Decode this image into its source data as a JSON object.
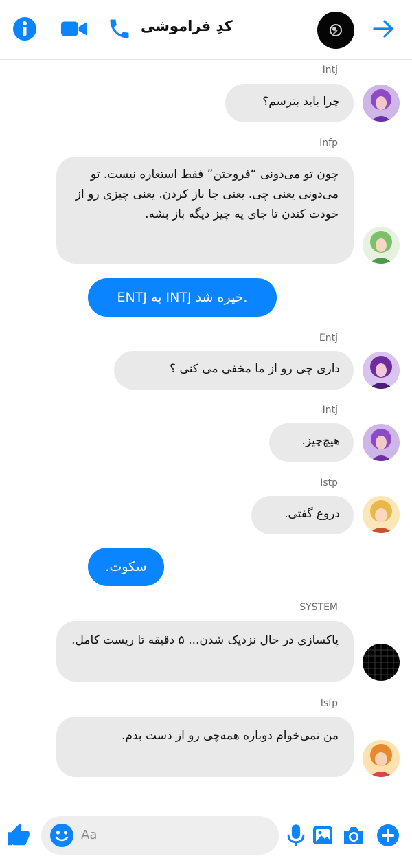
{
  "header": {
    "title": "کدِ فراموشی",
    "icons": [
      "info-icon",
      "video-call-icon",
      "phone-icon",
      "arrow-right-icon"
    ],
    "accent": "#0a84ff"
  },
  "messages": [
    {
      "sender": "Intj",
      "text": "چرا باید بترسم؟",
      "avatar": "purple-hair"
    },
    {
      "sender": "Infp",
      "text": "چون تو می‌دونی “فروختن” فقط استعاره نیست. تو می‌دونی یعنی چی. یعنی جا باز کردن. یعنی چیزی رو از خودت کندن تا جای یه چیز دیگه باز بشه.",
      "avatar": "green-hair"
    },
    {
      "outgoing": true,
      "text": ".خیره شد INTJ به ENTJ"
    },
    {
      "sender": "Entj",
      "text": "داری چی رو از ما مخفی می کنی ؟",
      "avatar": "purple-dark"
    },
    {
      "sender": "Intj",
      "text": "هیچ‌چیز.",
      "avatar": "purple-hair"
    },
    {
      "sender": "Istp",
      "text": "دروغ گفتی.",
      "avatar": "blonde"
    },
    {
      "outgoing": true,
      "text": "سکوت."
    },
    {
      "sender": "SYSTEM",
      "text": "پاکسازی در حال نزدیک شدن... ۵ دقیقه تا ریست کامل.",
      "avatar": "grid-black"
    },
    {
      "sender": "Isfp",
      "text": "من نمی‌خوام دوباره همه‌چی رو از دست بدم.",
      "avatar": "orange-hair"
    }
  ],
  "composer": {
    "placeholder": "Aa",
    "icons": [
      "like-icon",
      "emoji-icon",
      "mic-icon",
      "image-icon",
      "camera-icon",
      "plus-icon"
    ]
  }
}
